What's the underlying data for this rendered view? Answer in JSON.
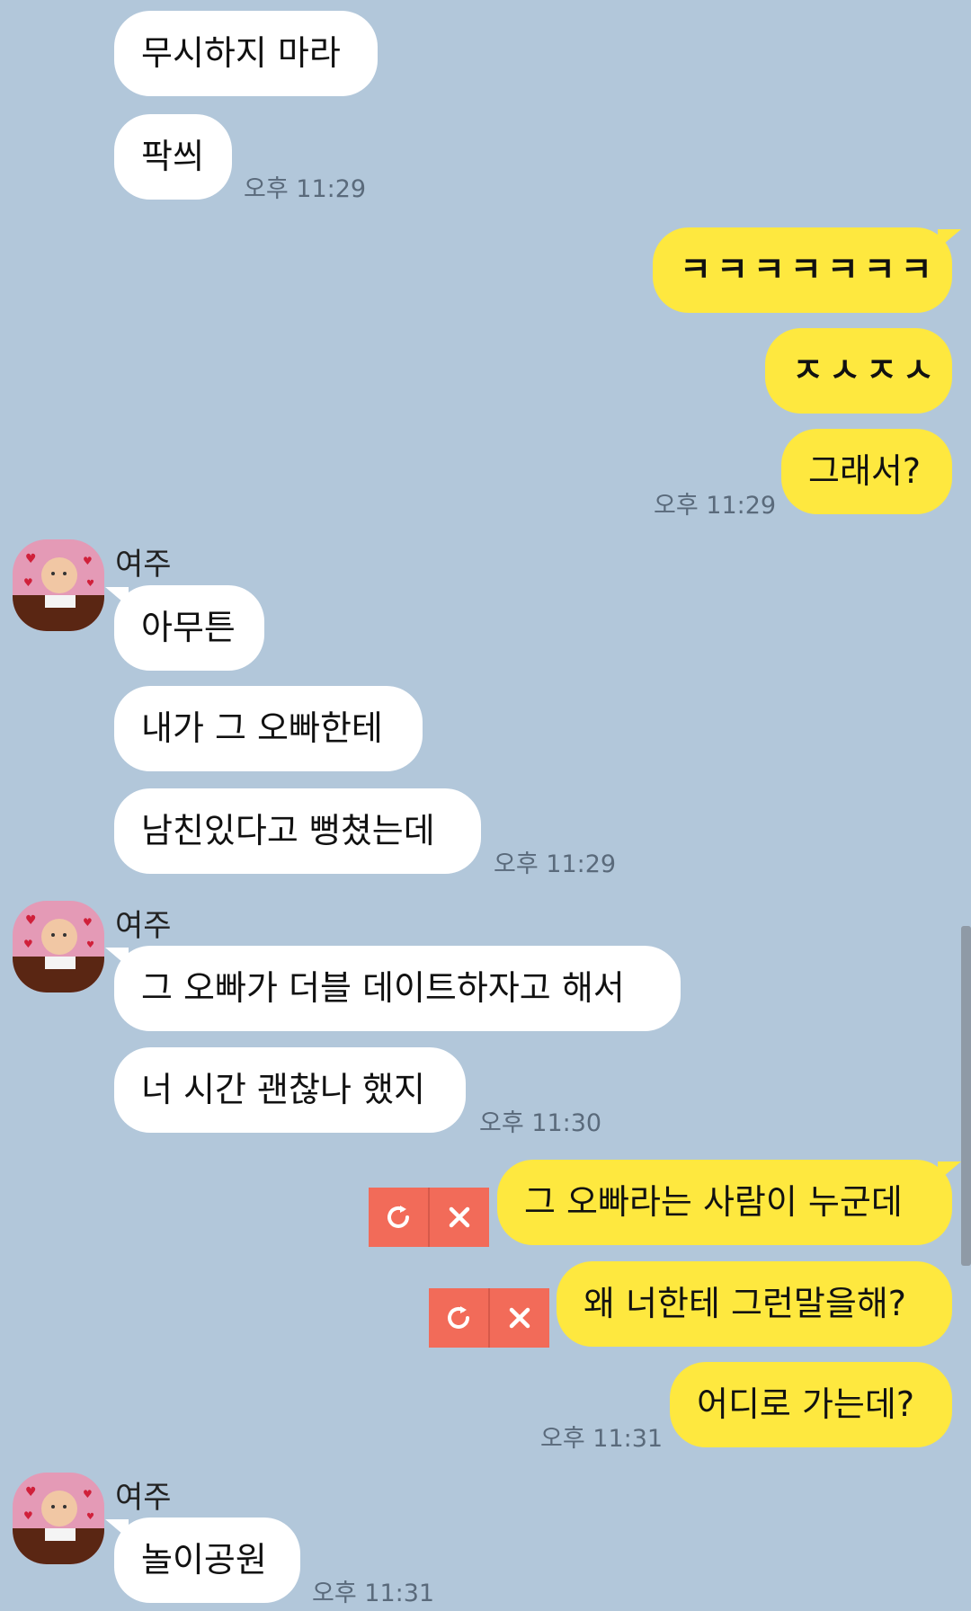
{
  "sender_name": "여주",
  "messages": {
    "m1": "무시하지 마라",
    "m2": "팍씌",
    "m3": "ㅋㅋㅋㅋㅋㅋㅋ",
    "m4": "ㅈㅅㅈㅅ",
    "m5": "그래서?",
    "m6": "아무튼",
    "m7": "내가 그 오빠한테",
    "m8": "남친있다고 뻥쳤는데",
    "m9": "그 오빠가 더블 데이트하자고 해서",
    "m10": "너 시간 괜찮나 했지",
    "m11": "그 오빠라는 사람이 누군데",
    "m12": "왜 너한테 그런말을해?",
    "m13": "어디로 가는데?",
    "m14": "놀이공원"
  },
  "times": {
    "t1": "오후 11:29",
    "t2": "오후 11:29",
    "t3": "오후 11:29",
    "t4": "오후 11:30",
    "t5": "오후 11:31",
    "t6": "오후 11:31"
  },
  "icons": {
    "avatar": "cartoon-character-with-hearts",
    "resend": "retry-icon",
    "cancel": "close-icon"
  },
  "colors": {
    "background": "#b2c7da",
    "incoming_bubble": "#ffffff",
    "outgoing_bubble": "#fee83f",
    "failed_action": "#f26b59"
  }
}
